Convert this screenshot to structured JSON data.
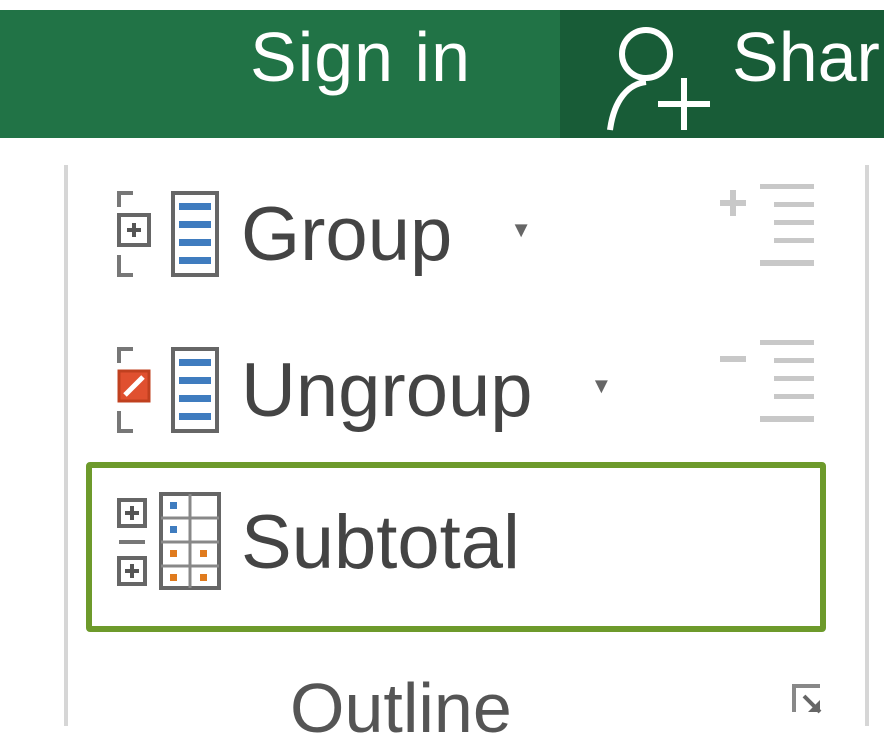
{
  "titlebar": {
    "sign_in": "Sign in",
    "share": "Shar"
  },
  "outline_group": {
    "label": "Outline",
    "commands": {
      "group": "Group",
      "ungroup": "Ungroup",
      "subtotal": "Subtotal"
    }
  },
  "colors": {
    "ribbon_green": "#217346",
    "ribbon_dark_green": "#185c37",
    "highlight_border": "#6d9a2b",
    "icon_blue": "#3f7cbf",
    "icon_orange": "#e07b1e",
    "icon_red": "#e0502f"
  },
  "icons": [
    "user-add-icon",
    "group-icon",
    "ungroup-icon",
    "subtotal-icon",
    "show-detail-icon",
    "hide-detail-icon",
    "dialog-launcher-icon"
  ]
}
